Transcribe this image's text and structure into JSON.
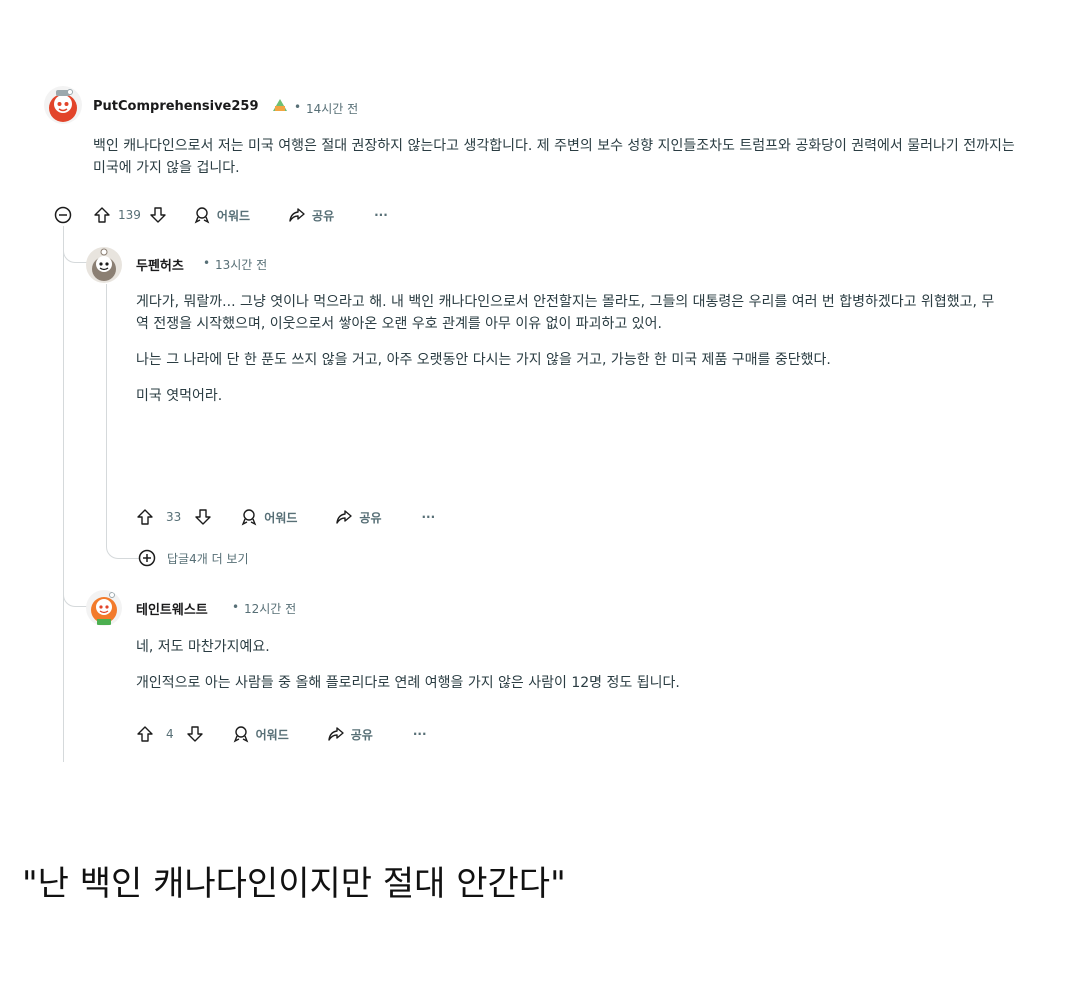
{
  "comments": [
    {
      "username": "PutComprehensive259",
      "time": "14시간 전",
      "paragraphs": [
        "백인 캐나다인으로서 저는 미국 여행은 절대 권장하지 않는다고 생각합니다. 제 주변의 보수 성향 지인들조차도 트럼프와 공화당이 권력에서 물러나기 전까지는 미국에 가지 않을 겁니다."
      ],
      "votes": "139",
      "award_label": "어워드",
      "share_label": "공유",
      "more_label": "···"
    },
    {
      "username": "두펜허츠",
      "time": "13시간 전",
      "paragraphs": [
        "게다가, 뭐랄까... 그냥 엿이나 먹으라고 해. 내 백인 캐나다인으로서 안전할지는 몰라도, 그들의 대통령은 우리를 여러 번 합병하겠다고 위협했고, 무역 전쟁을 시작했으며, 이웃으로서 쌓아온 오랜 우호 관계를 아무 이유 없이 파괴하고 있어.",
        "나는 그 나라에 단 한 푼도 쓰지 않을 거고, 아주 오랫동안 다시는 가지 않을 거고, 가능한 한 미국 제품 구매를 중단했다.",
        "미국 엿먹어라."
      ],
      "votes": "33",
      "award_label": "어워드",
      "share_label": "공유",
      "more_label": "···",
      "more_replies": "답글4개 더 보기"
    },
    {
      "username": "테인트웨스트",
      "time": "12시간 전",
      "paragraphs": [
        "네, 저도 마찬가지예요.",
        "개인적으로 아는 사람들 중 올해 플로리다로 연례 여행을 가지 않은 사람이 12명 정도 됩니다."
      ],
      "votes": "4",
      "award_label": "어워드",
      "share_label": "공유",
      "more_label": "···"
    }
  ],
  "separator": "•",
  "caption": "\"난 백인 캐나다인이지만 절대 안간다\"",
  "colors": {
    "avatar_red": "#e2442a",
    "avatar_orange": "#f27a2b",
    "thread_line": "#d5d9db",
    "meta_text": "#576f76",
    "body_text": "#2a3c42"
  }
}
